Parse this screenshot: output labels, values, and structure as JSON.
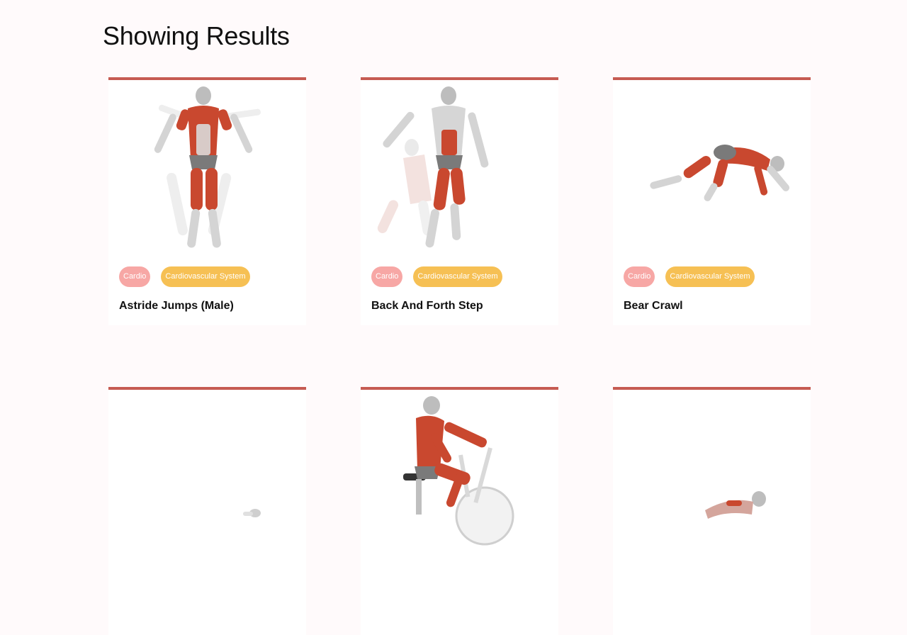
{
  "header": {
    "title": "Showing Results"
  },
  "exercises": [
    {
      "name": "Astride Jumps (Male)",
      "tags": [
        "Cardio",
        "Cardiovascular System"
      ]
    },
    {
      "name": "Back And Forth Step",
      "tags": [
        "Cardio",
        "Cardiovascular System"
      ]
    },
    {
      "name": "Bear Crawl",
      "tags": [
        "Cardio",
        "Cardiovascular System"
      ]
    },
    {
      "name": "",
      "tags": []
    },
    {
      "name": "",
      "tags": []
    },
    {
      "name": "",
      "tags": []
    }
  ],
  "colors": {
    "background": "#fffafb",
    "card_border": "#c65b52",
    "tag_body_part": "#f7a7a5",
    "tag_target": "#f6c054",
    "muscle_red": "#c9482f",
    "body_grey": "#d9d9d9"
  },
  "icons": [
    "exercise-illustration-image"
  ]
}
